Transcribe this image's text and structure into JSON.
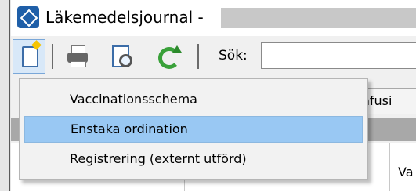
{
  "window": {
    "title": "Läkemedelsjournal -",
    "app_icon": "app-logo-icon"
  },
  "toolbar": {
    "buttons": [
      {
        "name": "new-document-icon",
        "active": true
      },
      {
        "name": "print-icon"
      },
      {
        "name": "print-preview-icon"
      },
      {
        "name": "refresh-icon"
      }
    ],
    "search_label": "Sök:",
    "search_value": ""
  },
  "menu": {
    "items": [
      {
        "label": "Vaccinationsschema",
        "highlighted": false
      },
      {
        "label": "Enstaka ordination",
        "highlighted": true
      },
      {
        "label": "Registrering (externt utförd)",
        "highlighted": false
      }
    ]
  },
  "background": {
    "tab_label": "Infusi",
    "column_header": "Va"
  },
  "colors": {
    "menu_highlight": "#99c8f3",
    "menu_background": "#f2f2f2",
    "toolbar_background": "#f0f0f0",
    "band": "#a8a8a8"
  }
}
